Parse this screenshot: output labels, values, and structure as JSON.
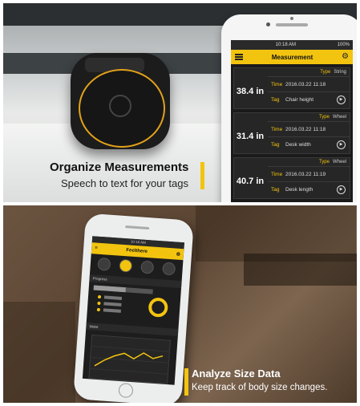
{
  "top_panel": {
    "caption_title": "Organize Measurements",
    "caption_subtitle": "Speech to text for your tags",
    "phone": {
      "status_time": "10:18 AM",
      "status_battery": "100%",
      "title": "Measurement",
      "records": [
        {
          "type_label": "Type",
          "type": "String",
          "measurement": "38.4 in",
          "time_label": "Time",
          "time": "2016.03.22  11:18",
          "tag_label": "Tag",
          "tag": "Chair height"
        },
        {
          "type_label": "Type",
          "type": "Wheel",
          "measurement": "31.4 in",
          "time_label": "Time",
          "time": "2016.03.22  11:18",
          "tag_label": "Tag",
          "tag": "Desk width"
        },
        {
          "type_label": "Type",
          "type": "Wheel",
          "measurement": "40.7 in",
          "time_label": "Time",
          "time": "2016.03.22  11:19",
          "tag_label": "Tag",
          "tag": "Desk length"
        }
      ]
    }
  },
  "bottom_panel": {
    "caption_title": "Analyze Size Data",
    "caption_subtitle": "Keep track of body size changes.",
    "phone": {
      "status_time": "10:18 AM",
      "title": "Feelthere",
      "section_progress": "Progress",
      "section_chart": "Waist"
    }
  },
  "colors": {
    "accent": "#f2c40f",
    "screen_bg": "#1a1a1a"
  },
  "icons": [
    "menu-icon",
    "gear-icon",
    "play-icon"
  ]
}
